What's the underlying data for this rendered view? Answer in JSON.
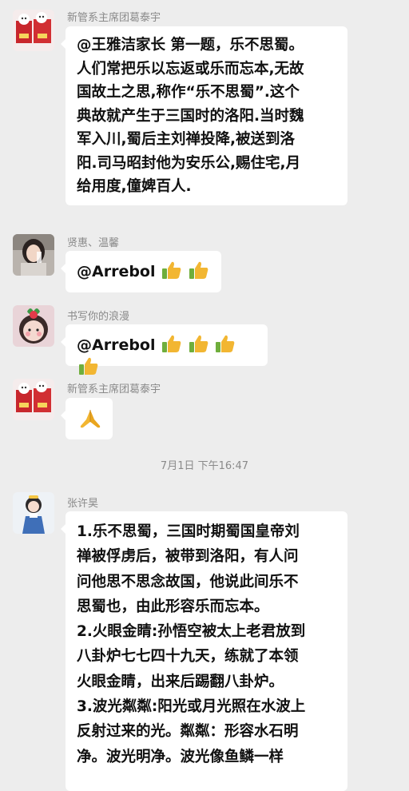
{
  "messages": [
    {
      "sender": "新管系主席团葛泰宇",
      "text": "@王雅洁家长  第一题，乐不思蜀。\n人们常把乐以忘返或乐而忘本,无故\n国故土之思,称作“乐不思蜀”.这个\n典故就产生于三国时的洛阳.当时魏\n军入川,蜀后主刘禅投降,被送到洛\n阳.司马昭封他为安乐公,赐住宅,月\n给用度,僮婢百人."
    },
    {
      "sender": "贤惠、温馨",
      "text": "@Arrebol",
      "emoji": [
        "thumbs-up",
        "thumbs-up"
      ]
    },
    {
      "sender": "书写你的浪漫",
      "text": "@Arrebol",
      "emoji": [
        "thumbs-up",
        "thumbs-up",
        "thumbs-up",
        "thumbs-up"
      ]
    },
    {
      "sender": "新管系主席团葛泰宇",
      "emoji": [
        "folded-hands"
      ]
    },
    {
      "sender": "张许昊",
      "text": "1.乐不思蜀，三国时期蜀国皇帝刘\n禅被俘虏后，被带到洛阳，有人问\n问他思不思念故国，他说此间乐不\n思蜀也，由此形容乐而忘本。\n2.火眼金睛:孙悟空被太上老君放到\n八卦炉七七四十九天，练就了本领\n火眼金睛，出来后踢翻八卦炉。\n3.波光粼粼:阳光或月光照在水波上\n反射过来的光。粼粼：形容水石明\n净。波光明净。波光像鱼鳞一样"
    }
  ],
  "time_divider": "7月1日 下午16:47",
  "colors": {
    "background": "#ededed",
    "bubble": "#ffffff",
    "sender_text": "#8a8a8a",
    "thumb": "#f2b632"
  }
}
